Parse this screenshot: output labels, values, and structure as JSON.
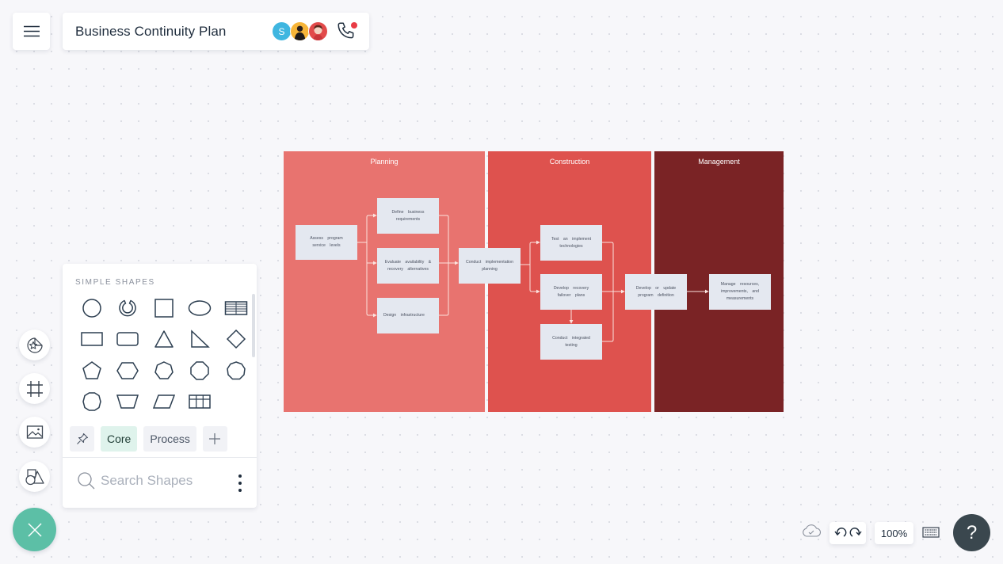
{
  "header": {
    "menu_icon": "hamburger-icon",
    "title": "Business Continuity Plan",
    "collaborators": [
      {
        "initial": "S",
        "color": "#3fb6e0"
      },
      {
        "initial": "",
        "color": "#f7b538"
      },
      {
        "initial": "",
        "color": "#e24a4a"
      }
    ],
    "call_icon": "phone-icon",
    "call_indicator_color": "#e83b45"
  },
  "diagram": {
    "lanes": [
      {
        "title": "Planning",
        "color": "#e8736f"
      },
      {
        "title": "Construction",
        "color": "#de524e"
      },
      {
        "title": "Management",
        "color": "#7a2325"
      }
    ],
    "nodes": {
      "assess": "Assess program service levels",
      "define": "Define business requirements",
      "evaluate": "Evaluate availability & recovery alternatives",
      "design": "Design infrastructure",
      "conduct_planning": "Conduct implementation planning",
      "test": "Test an implement technologies",
      "develop_recovery": "Develop recovery failover plans",
      "conduct_testing": "Conduct integrated testing",
      "develop_program": "Develop or update program definition",
      "manage": "Manage resources, improvements, and measurements"
    }
  },
  "shape_panel": {
    "heading": "SIMPLE SHAPES",
    "shapes": [
      "circle",
      "arc",
      "square",
      "ellipse",
      "table",
      "rectangle",
      "rounded-rectangle",
      "triangle",
      "right-triangle",
      "diamond",
      "pentagon",
      "hexagon",
      "heptagon",
      "octagon",
      "nonagon",
      "decagon",
      "trapezoid",
      "parallelogram",
      "grid"
    ],
    "tabs": {
      "pin_icon": "pin-icon",
      "core": "Core",
      "process": "Process",
      "add_icon": "plus-icon"
    },
    "search_placeholder": "Search Shapes"
  },
  "rail": [
    "sticker-icon",
    "frame-icon",
    "image-icon",
    "shapes-icon"
  ],
  "footer": {
    "zoom": "100%",
    "help": "?"
  }
}
